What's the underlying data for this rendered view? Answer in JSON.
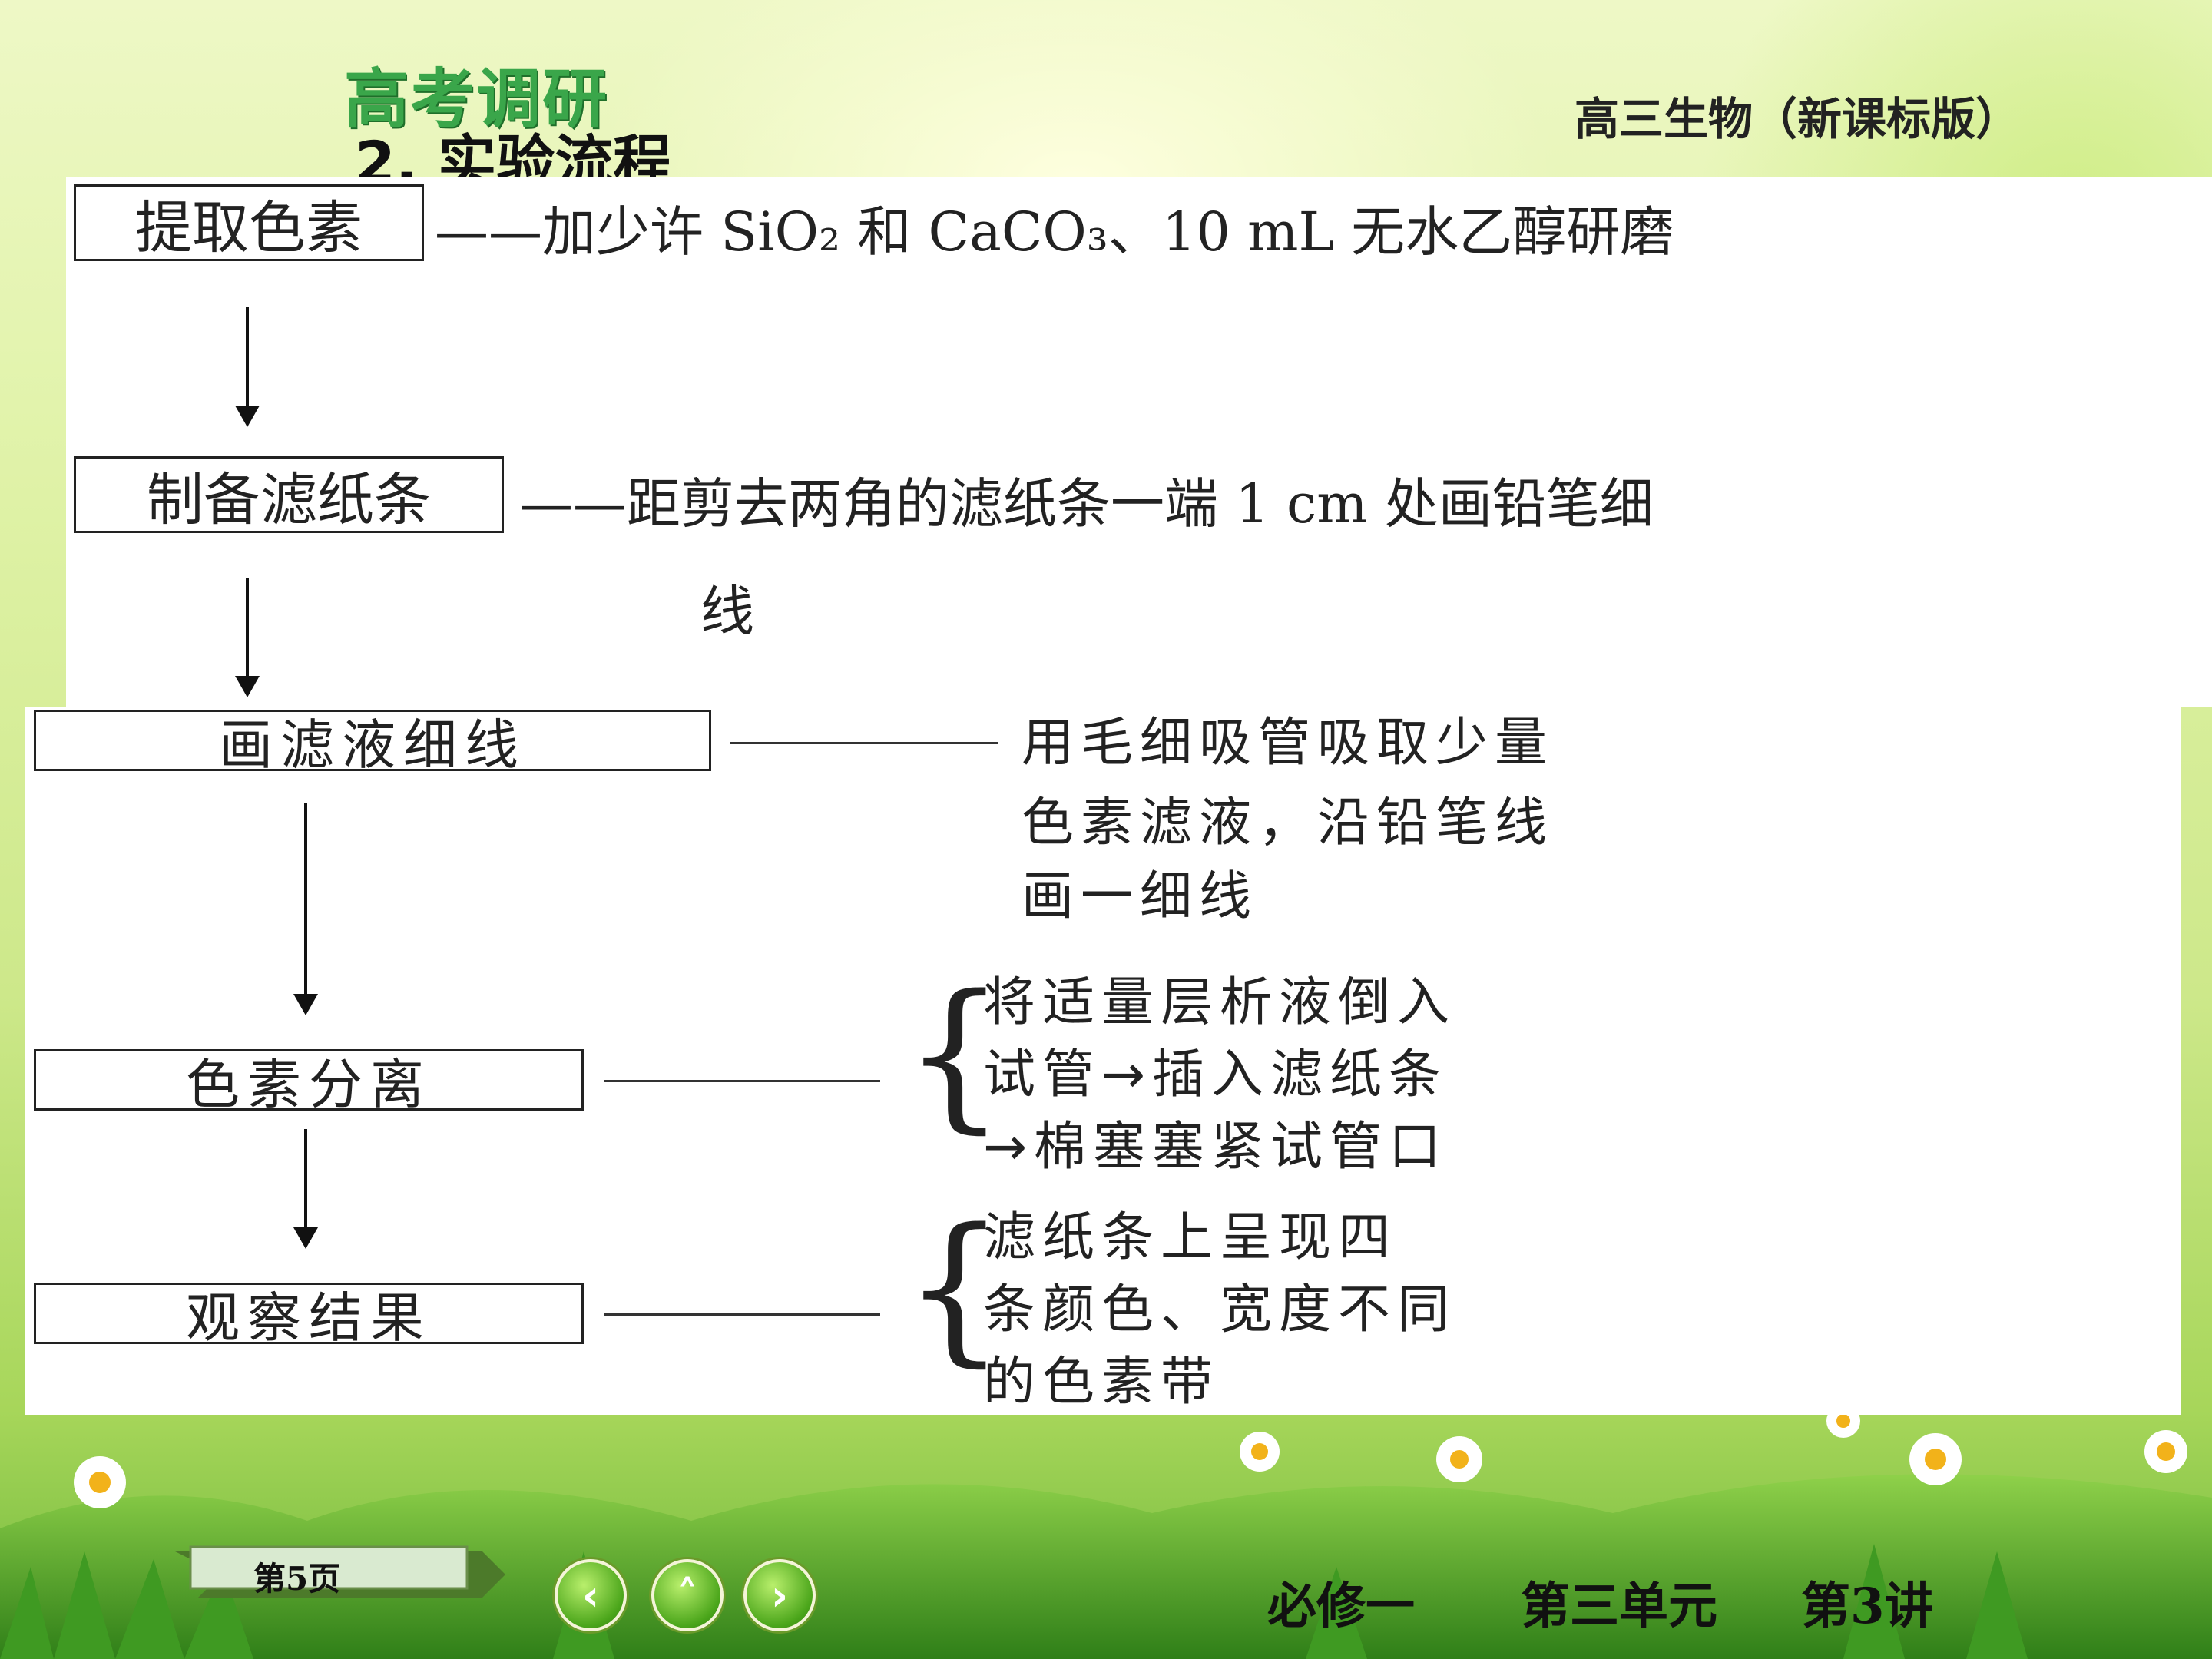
{
  "header": {
    "title": "高考调研",
    "subtitle": "高三生物（新课标版）",
    "section": "2. 实验流程"
  },
  "flow": {
    "step1": {
      "label": "提取色素",
      "desc": "——加少许 SiO₂ 和 CaCO₃、10 mL 无水乙醇研磨"
    },
    "step2": {
      "label": "制备滤纸条",
      "desc_line1": "——距剪去两角的滤纸条一端 1 cm 处画铅笔细",
      "desc_line2": "线"
    },
    "step3": {
      "label": "画滤液细线",
      "desc_line1": "用毛细吸管吸取少量",
      "desc_line2": "色素滤液，沿铅笔线",
      "desc_line3": "画一细线"
    },
    "step4": {
      "label": "色素分离",
      "desc_line1": "将适量层析液倒入",
      "desc_line2": "试管→插入滤纸条",
      "desc_line3": "→棉塞塞紧试管口"
    },
    "step5": {
      "label": "观察结果",
      "desc_line1": "滤纸条上呈现四",
      "desc_line2": "条颜色、宽度不同",
      "desc_line3": "的色素带"
    }
  },
  "nav": {
    "page": "第5页",
    "prev_icon": "chevron-left-icon",
    "up_icon": "chevron-up-icon",
    "next_icon": "chevron-right-icon",
    "prev_glyph": "‹",
    "up_glyph": "˄",
    "next_glyph": "›"
  },
  "footer": {
    "course": "必修一",
    "unit": "第三单元",
    "lecture": "第3讲"
  },
  "colors": {
    "title_green": "#3aa64a",
    "grass_green": "#6fb83a",
    "button_green": "#4aa51a"
  }
}
